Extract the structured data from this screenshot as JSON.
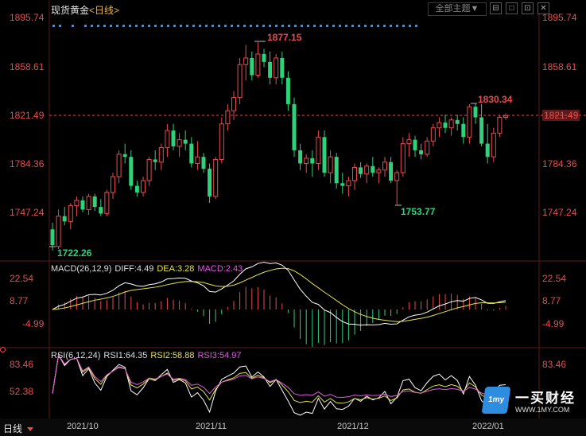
{
  "header": {
    "instrument": "现货黄金",
    "period_open": "<",
    "period": "日线",
    "period_close": ">",
    "theme_button": "全部主题▼"
  },
  "window_buttons": [
    "⊟",
    "□",
    "⊡",
    "✕"
  ],
  "price_axis": {
    "labels": [
      "1895.74",
      "1858.61",
      "1821.49",
      "1784.36",
      "1747.24"
    ],
    "current_price": "1821.49"
  },
  "annotations": {
    "high": "1877.15",
    "recent_high": "1830.34",
    "recent_low": "1753.77",
    "low": "1722.26"
  },
  "macd": {
    "name": "MACD(26,12,9)",
    "diff": "DIFF:4.49",
    "dea": "DEA:3.28",
    "macd": "MACD:2.43",
    "axis_labels": [
      "22.54",
      "8.77",
      "-4.99"
    ]
  },
  "rsi": {
    "name": "RSI(6,12,24)",
    "rsi1": "RSI1:64.35",
    "rsi2": "RSI2:58.88",
    "rsi3": "RSI3:54.97",
    "axis_labels": [
      "83.46",
      "52.38"
    ]
  },
  "time_axis": {
    "period_tab": "日线",
    "dates": [
      "2021/10",
      "2021/11",
      "2021/12",
      "2022/01"
    ]
  },
  "logo": {
    "badge": "1my",
    "name": "一买财经",
    "url": "WWW.1MY.COM"
  },
  "colors": {
    "up": "#e84d4d",
    "down": "#2fd17a",
    "diff": "#ffffff",
    "dea": "#e6e24a",
    "macd": "#e05be0"
  },
  "chart_data": {
    "type": "candlestick",
    "ylim": [
      1720,
      1900
    ],
    "candles": [
      [
        1735,
        1740,
        1719,
        1723
      ],
      [
        1722,
        1750,
        1720,
        1745
      ],
      [
        1745,
        1752,
        1738,
        1741
      ],
      [
        1741,
        1755,
        1735,
        1753
      ],
      [
        1753,
        1760,
        1745,
        1757
      ],
      [
        1757,
        1760,
        1748,
        1750
      ],
      [
        1750,
        1762,
        1746,
        1760
      ],
      [
        1760,
        1762,
        1749,
        1752
      ],
      [
        1752,
        1758,
        1745,
        1747
      ],
      [
        1747,
        1765,
        1745,
        1763
      ],
      [
        1763,
        1778,
        1758,
        1775
      ],
      [
        1775,
        1795,
        1770,
        1792
      ],
      [
        1792,
        1800,
        1785,
        1790
      ],
      [
        1790,
        1795,
        1765,
        1768
      ],
      [
        1768,
        1772,
        1760,
        1763
      ],
      [
        1763,
        1775,
        1760,
        1772
      ],
      [
        1772,
        1790,
        1768,
        1788
      ],
      [
        1788,
        1795,
        1780,
        1786
      ],
      [
        1786,
        1800,
        1780,
        1797
      ],
      [
        1797,
        1815,
        1790,
        1810
      ],
      [
        1810,
        1815,
        1795,
        1798
      ],
      [
        1798,
        1808,
        1790,
        1803
      ],
      [
        1803,
        1810,
        1795,
        1800
      ],
      [
        1800,
        1805,
        1782,
        1785
      ],
      [
        1785,
        1802,
        1780,
        1790
      ],
      [
        1790,
        1793,
        1778,
        1781
      ],
      [
        1781,
        1785,
        1755,
        1760
      ],
      [
        1760,
        1790,
        1758,
        1788
      ],
      [
        1788,
        1820,
        1785,
        1815
      ],
      [
        1815,
        1830,
        1810,
        1825
      ],
      [
        1825,
        1840,
        1818,
        1835
      ],
      [
        1835,
        1865,
        1830,
        1860
      ],
      [
        1860,
        1875,
        1848,
        1865
      ],
      [
        1865,
        1870,
        1848,
        1852
      ],
      [
        1852,
        1877,
        1850,
        1868
      ],
      [
        1868,
        1872,
        1858,
        1862
      ],
      [
        1862,
        1870,
        1845,
        1850
      ],
      [
        1850,
        1868,
        1845,
        1865
      ],
      [
        1865,
        1870,
        1845,
        1850
      ],
      [
        1850,
        1855,
        1825,
        1830
      ],
      [
        1830,
        1835,
        1790,
        1795
      ],
      [
        1795,
        1800,
        1780,
        1785
      ],
      [
        1785,
        1792,
        1778,
        1789
      ],
      [
        1789,
        1795,
        1775,
        1785
      ],
      [
        1785,
        1810,
        1780,
        1805
      ],
      [
        1805,
        1810,
        1775,
        1778
      ],
      [
        1778,
        1795,
        1770,
        1790
      ],
      [
        1790,
        1793,
        1766,
        1770
      ],
      [
        1770,
        1778,
        1762,
        1768
      ],
      [
        1768,
        1775,
        1760,
        1772
      ],
      [
        1772,
        1785,
        1765,
        1782
      ],
      [
        1782,
        1786,
        1774,
        1777
      ],
      [
        1777,
        1785,
        1770,
        1783
      ],
      [
        1783,
        1790,
        1775,
        1778
      ],
      [
        1778,
        1782,
        1770,
        1780
      ],
      [
        1780,
        1790,
        1775,
        1786
      ],
      [
        1786,
        1790,
        1770,
        1772
      ],
      [
        1772,
        1780,
        1754,
        1778
      ],
      [
        1778,
        1805,
        1775,
        1800
      ],
      [
        1800,
        1808,
        1790,
        1803
      ],
      [
        1803,
        1806,
        1790,
        1795
      ],
      [
        1795,
        1800,
        1788,
        1792
      ],
      [
        1792,
        1805,
        1790,
        1802
      ],
      [
        1802,
        1815,
        1798,
        1812
      ],
      [
        1812,
        1820,
        1805,
        1816
      ],
      [
        1816,
        1822,
        1808,
        1812
      ],
      [
        1812,
        1820,
        1806,
        1818
      ],
      [
        1818,
        1822,
        1810,
        1815
      ],
      [
        1815,
        1820,
        1800,
        1805
      ],
      [
        1805,
        1830,
        1800,
        1828
      ],
      [
        1828,
        1830,
        1815,
        1820
      ],
      [
        1820,
        1830,
        1798,
        1800
      ],
      [
        1800,
        1815,
        1785,
        1790
      ],
      [
        1790,
        1812,
        1786,
        1808
      ],
      [
        1808,
        1822,
        1805,
        1820
      ],
      [
        1820,
        1823,
        1818,
        1821
      ]
    ]
  }
}
